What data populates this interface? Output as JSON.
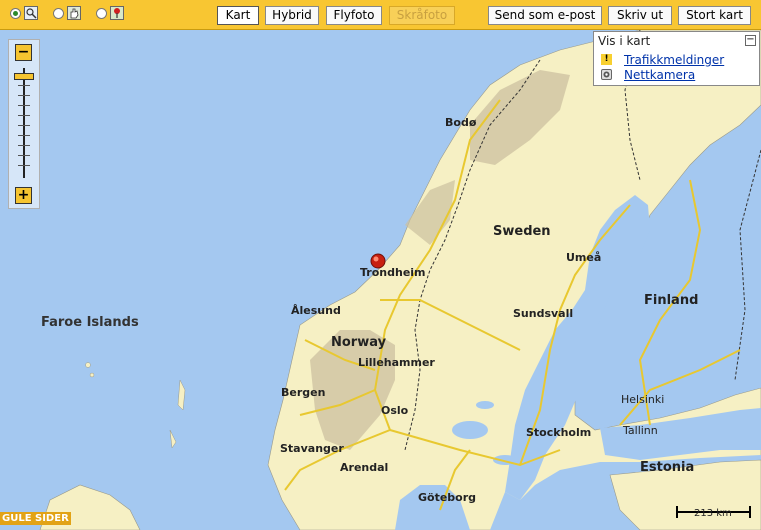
{
  "toolbar": {
    "modes": [
      {
        "name": "zoom-mode",
        "selected": true
      },
      {
        "name": "pan-mode",
        "selected": false
      },
      {
        "name": "marker-mode",
        "selected": false
      }
    ],
    "map_types": [
      "Kart",
      "Hybrid",
      "Flyfoto",
      "Skråfoto"
    ],
    "active_map_type": "Kart",
    "disabled_map_type": "Skråfoto",
    "actions": [
      "Send som e-post",
      "Skriv ut",
      "Stort kart"
    ]
  },
  "zoom": {
    "zoom_in": "+",
    "zoom_out": "−"
  },
  "panel": {
    "title": "Vis i kart",
    "collapse": "−",
    "links": [
      {
        "label": "Trafikkmeldinger",
        "icon": "warning-icon"
      },
      {
        "label": "Nettkamera",
        "icon": "camera-icon"
      }
    ]
  },
  "map": {
    "countries": [
      "Sweden",
      "Norway",
      "Finland",
      "Estonia"
    ],
    "regions": [
      "Faroe Islands"
    ],
    "cities": [
      "Bodø",
      "Trondheim",
      "Umeå",
      "Ålesund",
      "Sundsvall",
      "Lillehammer",
      "Bergen",
      "Oslo",
      "Helsinki",
      "Stockholm",
      "Tallinn",
      "Stavanger",
      "Arendal",
      "Göteborg"
    ],
    "marker": "location-pin"
  },
  "branding": {
    "logo": "GULE SIDER"
  },
  "scale": {
    "label": "213 km"
  },
  "colors": {
    "toolbar": "#f8c632",
    "water": "#a4c8f0",
    "land": "#f6f0c4",
    "roads": "#e8c830",
    "mountains": "#c8b890"
  }
}
